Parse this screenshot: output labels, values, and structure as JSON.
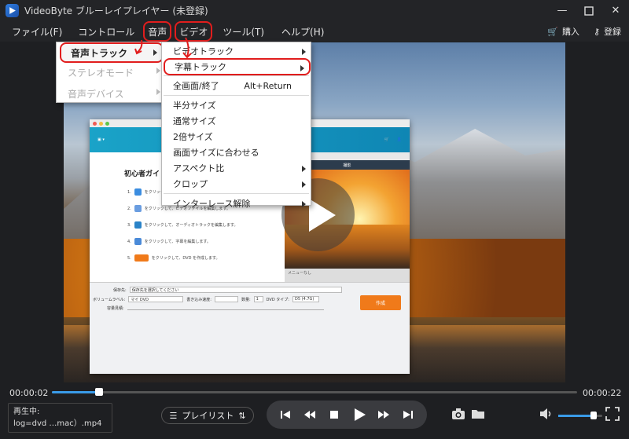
{
  "window": {
    "title": "VideoByte ブルーレイプレイヤー (未登録)"
  },
  "menubar": {
    "items": [
      "ファイル(F)",
      "コントロール",
      "音声",
      "ビデオ",
      "ツール(T)",
      "ヘルプ(H)"
    ],
    "purchase": "購入",
    "register": "登録"
  },
  "audio_menu": {
    "items": [
      "音声トラック",
      "ステレオモード",
      "音声デバイス"
    ]
  },
  "video_menu": {
    "items": [
      {
        "label": "ビデオトラック",
        "shortcut": "",
        "submenu": true
      },
      {
        "label": "字幕トラック",
        "shortcut": "",
        "submenu": true
      },
      {
        "label": "全画面/終了",
        "shortcut": "Alt+Return",
        "submenu": false
      },
      {
        "label": "半分サイズ",
        "shortcut": "",
        "submenu": false
      },
      {
        "label": "通常サイズ",
        "shortcut": "",
        "submenu": false
      },
      {
        "label": "2倍サイズ",
        "shortcut": "",
        "submenu": false
      },
      {
        "label": "画面サイズに合わせる",
        "shortcut": "",
        "submenu": false
      },
      {
        "label": "アスペクト比",
        "shortcut": "",
        "submenu": true
      },
      {
        "label": "クロップ",
        "shortcut": "",
        "submenu": true
      },
      {
        "label": "インターレース解除",
        "shortcut": "",
        "submenu": true
      }
    ]
  },
  "video_content": {
    "guide_title": "初心者ガイド",
    "steps": [
      "をクリック…",
      "をクリックして、ビデオファイルを編集します。",
      "をクリックして、オーディオトラックを編集します。",
      "をクリックして、字幕を編集します。",
      "をクリックして、DVD を作成します。"
    ],
    "preview_label": "撮影",
    "preview_tab": "プレビュー",
    "menu_none": "メニューなし",
    "save_label": "保存先:",
    "save_value": "保存先を選択してください",
    "volume_label": "ボリュームラベル:",
    "volume_value": "マイ DVD",
    "write_speed": "書き込み速度:",
    "count_label": "数量:",
    "count_value": "1",
    "dvd_type": "DVD タイプ:",
    "dvd_type_value": "D5 (4.7G)",
    "capacity": "容量見積:",
    "make": "作成"
  },
  "player": {
    "time_current": "00:00:02",
    "time_total": "00:00:22",
    "progress": 0.09,
    "status_label": "再生中:",
    "status_file": "log=dvd …mac）.mp4",
    "playlist": "プレイリスト",
    "volume": 0.8
  },
  "colors": {
    "accent": "#3a9be8",
    "highlight": "#e11d1d",
    "bg": "#1e1f22"
  }
}
